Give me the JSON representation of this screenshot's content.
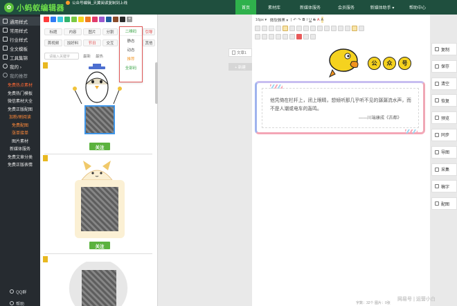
{
  "brand": {
    "name": "小蚂蚁编辑器",
    "logo_glyph": "✿"
  },
  "notice": "公众号编辑_天翼阅读复制到上线",
  "nav": {
    "items": [
      {
        "label": "首页",
        "active": true
      },
      {
        "label": "素材库",
        "active": false
      },
      {
        "label": "新媒体服务",
        "active": false
      },
      {
        "label": "会员服务",
        "active": false
      },
      {
        "label": "新媒体助手 ▾",
        "active": false
      },
      {
        "label": "帮助中心",
        "active": false
      }
    ]
  },
  "sidebar": {
    "items": [
      {
        "label": "通用样式",
        "icon": "grid-icon",
        "active": true
      },
      {
        "label": "常用样式",
        "icon": "heart-icon",
        "active": false
      },
      {
        "label": "行业样式",
        "icon": "folder-icon",
        "active": false
      },
      {
        "label": "全文模板",
        "icon": "doc-icon",
        "active": false
      },
      {
        "label": "工具集锦",
        "icon": "tool-icon",
        "active": false
      },
      {
        "label": "我的 ›",
        "icon": "user-icon",
        "active": false
      }
    ],
    "recommend_label": "我的推荐",
    "subs": [
      {
        "label": "免费热点素材",
        "style": "hot"
      },
      {
        "label": "免费热门模板",
        "style": ""
      },
      {
        "label": "微信素材大全",
        "style": ""
      },
      {
        "label": "免费正版配图",
        "style": ""
      },
      {
        "label": "加粉/刷阅读",
        "style": "hot2"
      },
      {
        "label": "免费配图",
        "style": "hot3"
      },
      {
        "label": "涨单接单",
        "style": "hot3"
      },
      {
        "label": "图片素材",
        "style": ""
      },
      {
        "label": "新媒体服务",
        "style": ""
      },
      {
        "label": "免费文章分类",
        "style": ""
      },
      {
        "label": "免费正版表情",
        "style": ""
      }
    ],
    "qq_label": "QQ群",
    "help_label": "帮助"
  },
  "style_panel": {
    "swatches": [
      "#ff3b3b",
      "#2f7bf5",
      "#3ec7e0",
      "#31b36b",
      "#7ac943",
      "#f5d21f",
      "#f07a22",
      "#e23b6a",
      "#9b59d0",
      "#1f5f9f",
      "#8a4b2a",
      "#2b2b2b"
    ],
    "plus": "+",
    "tags_row1": [
      "标题",
      "内容",
      "图片",
      "分割"
    ],
    "tags_row2": [
      "背景",
      "二维码",
      "引导"
    ],
    "tags_row3": [
      "首视频",
      "加好料",
      "节日",
      "交互"
    ],
    "tags_row3_extra": "其他",
    "search_placeholder": "请输入关键字",
    "links": [
      "最新",
      "最热"
    ],
    "dropdown": [
      "二维码",
      "静态",
      "动态",
      "推荐",
      "全部码"
    ],
    "follow_label": "关注"
  },
  "doc": {
    "item_label": "文章1",
    "new_label": "+ 新建"
  },
  "editor": {
    "toolbar_row1": [
      "16px ▾",
      "微软雅黑 ▾",
      "|",
      "↶",
      "↷",
      "B",
      "I",
      "U",
      "S",
      "A",
      "A"
    ],
    "quote_text": "他凭倚在栏杆上，闭上眼睛，想倾听那几乎听不见的潺潺流水声，而不是人潮或电车的轰鸣。",
    "quote_source": "——川端康成《古都》",
    "badges": [
      "公",
      "众",
      "号"
    ],
    "status": "字数：32个  图片：0张"
  },
  "actions": [
    {
      "label": "复制",
      "icon": "copy-icon"
    },
    {
      "label": "保存",
      "icon": "save-icon"
    },
    {
      "label": "清空",
      "icon": "trash-icon"
    },
    {
      "label": "恢复",
      "icon": "restore-icon"
    },
    {
      "label": "预览",
      "icon": "eye-icon"
    },
    {
      "label": "同步",
      "icon": "sync-icon"
    },
    {
      "label": "导图",
      "icon": "image-icon"
    },
    {
      "label": "采集",
      "icon": "collect-icon"
    },
    {
      "label": "稿字",
      "icon": "word-icon"
    },
    {
      "label": "配图",
      "icon": "picture-icon"
    }
  ],
  "watermark": "网易号 | 运营小白"
}
